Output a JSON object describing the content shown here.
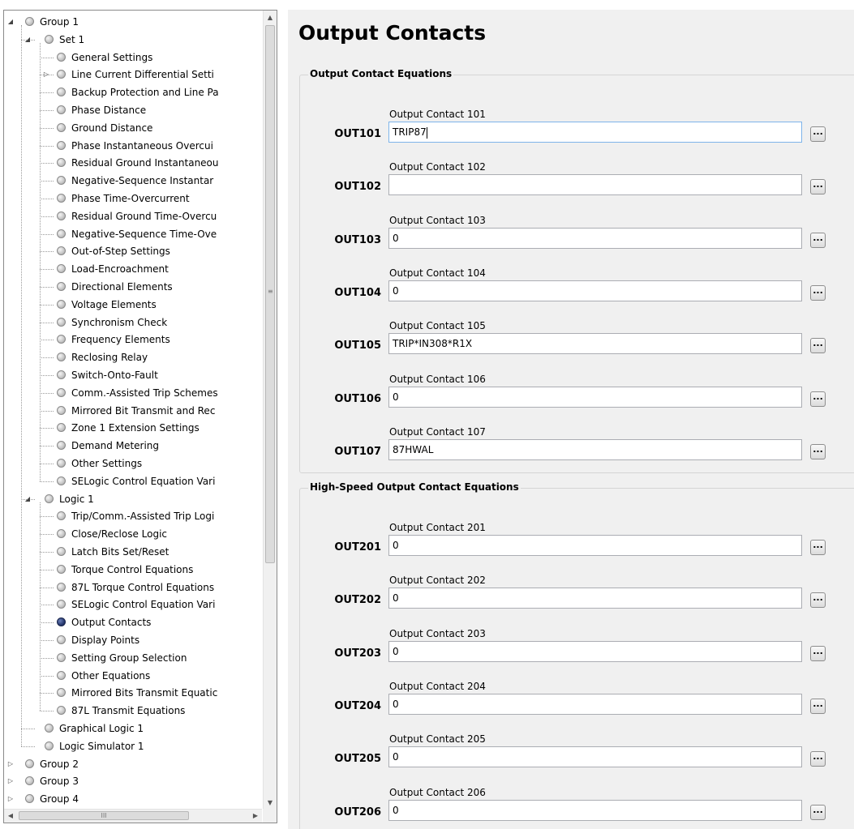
{
  "tree": {
    "rows": [
      {
        "label": "Group 1",
        "expander": "expanded"
      },
      {
        "label": "Set 1",
        "expander": "expanded"
      },
      {
        "label": "General Settings"
      },
      {
        "label": "Line Current Differential Setti",
        "expander": "collapsed"
      },
      {
        "label": "Backup Protection and Line Pa"
      },
      {
        "label": "Phase Distance"
      },
      {
        "label": "Ground Distance"
      },
      {
        "label": "Phase Instantaneous Overcui"
      },
      {
        "label": "Residual Ground Instantaneou"
      },
      {
        "label": "Negative-Sequence Instantar"
      },
      {
        "label": "Phase Time-Overcurrent"
      },
      {
        "label": "Residual Ground Time-Overcu"
      },
      {
        "label": "Negative-Sequence Time-Ove"
      },
      {
        "label": "Out-of-Step Settings"
      },
      {
        "label": "Load-Encroachment"
      },
      {
        "label": "Directional Elements"
      },
      {
        "label": "Voltage Elements"
      },
      {
        "label": "Synchronism Check"
      },
      {
        "label": "Frequency Elements"
      },
      {
        "label": "Reclosing Relay"
      },
      {
        "label": "Switch-Onto-Fault"
      },
      {
        "label": "Comm.-Assisted Trip Schemes"
      },
      {
        "label": "Mirrored Bit Transmit and Rec"
      },
      {
        "label": "Zone 1 Extension Settings"
      },
      {
        "label": "Demand Metering"
      },
      {
        "label": "Other Settings"
      },
      {
        "label": "SELogic Control Equation Vari"
      },
      {
        "label": "Logic 1",
        "expander": "expanded"
      },
      {
        "label": "Trip/Comm.-Assisted Trip Logi"
      },
      {
        "label": "Close/Reclose Logic"
      },
      {
        "label": "Latch Bits Set/Reset"
      },
      {
        "label": "Torque Control Equations"
      },
      {
        "label": "87L Torque Control Equations"
      },
      {
        "label": "SELogic Control Equation Vari"
      },
      {
        "label": "Output Contacts",
        "selected": true
      },
      {
        "label": "Display Points"
      },
      {
        "label": "Setting Group Selection"
      },
      {
        "label": "Other Equations"
      },
      {
        "label": "Mirrored Bits Transmit Equatic"
      },
      {
        "label": "87L Transmit Equations"
      },
      {
        "label": "Graphical Logic 1"
      },
      {
        "label": "Logic Simulator 1"
      },
      {
        "label": "Group 2",
        "expander": "collapsed"
      },
      {
        "label": "Group 3",
        "expander": "collapsed"
      },
      {
        "label": "Group 4",
        "expander": "collapsed"
      }
    ]
  },
  "main": {
    "title": "Output Contacts",
    "sections": [
      {
        "title": "Output Contact Equations",
        "fields": [
          {
            "key": "OUT101",
            "caption": "Output Contact 101",
            "value": "TRIP87",
            "focused": true
          },
          {
            "key": "OUT102",
            "caption": "Output Contact 102",
            "value": ""
          },
          {
            "key": "OUT103",
            "caption": "Output Contact 103",
            "value": "0"
          },
          {
            "key": "OUT104",
            "caption": "Output Contact 104",
            "value": "0"
          },
          {
            "key": "OUT105",
            "caption": "Output Contact 105",
            "value": "TRIP*IN308*R1X"
          },
          {
            "key": "OUT106",
            "caption": "Output Contact 106",
            "value": "0"
          },
          {
            "key": "OUT107",
            "caption": "Output Contact 107",
            "value": "87HWAL"
          }
        ]
      },
      {
        "title": "High-Speed Output Contact Equations",
        "fields": [
          {
            "key": "OUT201",
            "caption": "Output Contact 201",
            "value": "0"
          },
          {
            "key": "OUT202",
            "caption": "Output Contact 202",
            "value": "0"
          },
          {
            "key": "OUT203",
            "caption": "Output Contact 203",
            "value": "0"
          },
          {
            "key": "OUT204",
            "caption": "Output Contact 204",
            "value": "0"
          },
          {
            "key": "OUT205",
            "caption": "Output Contact 205",
            "value": "0"
          },
          {
            "key": "OUT206",
            "caption": "Output Contact 206",
            "value": "0"
          }
        ]
      }
    ],
    "browse_button_label": "..."
  },
  "scrollbar": {
    "grip": "≡",
    "hgrip": "III"
  },
  "colors": {
    "selected_node": "#283a70",
    "panel_bg": "#f0f0f0",
    "input_border": "#abadb3"
  }
}
